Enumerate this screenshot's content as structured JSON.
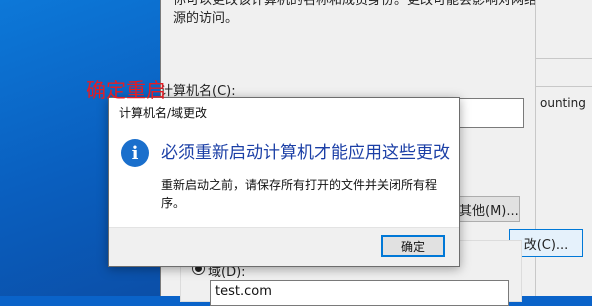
{
  "background_props": {
    "top_text_line1": "你可以更改该计算机的名称和成员身份。更改可能会影响对网络资",
    "top_text_line2": "源的访问。",
    "computer_name_label": "计算机名(C):",
    "other_button_label": "其他(M)...",
    "domain_radio_label": "域(D):",
    "domain_value": "test.com",
    "right_partial_text": "ounting",
    "change_button_label": "改(C)..."
  },
  "annotation": {
    "text": "确定重启",
    "color": "#e51c23"
  },
  "dialog": {
    "title": "计算机名/域更改",
    "icon": "info-icon",
    "main_instruction": "必须重新启动计算机才能应用这些更改",
    "body_text": "重新启动之前，请保存所有打开的文件并关闭所有程序。",
    "ok_label": "确定"
  },
  "colors": {
    "desktop_blue": "#0a63c9",
    "dialog_heading_blue": "#1b3fa6",
    "accent": "#0078d7"
  }
}
